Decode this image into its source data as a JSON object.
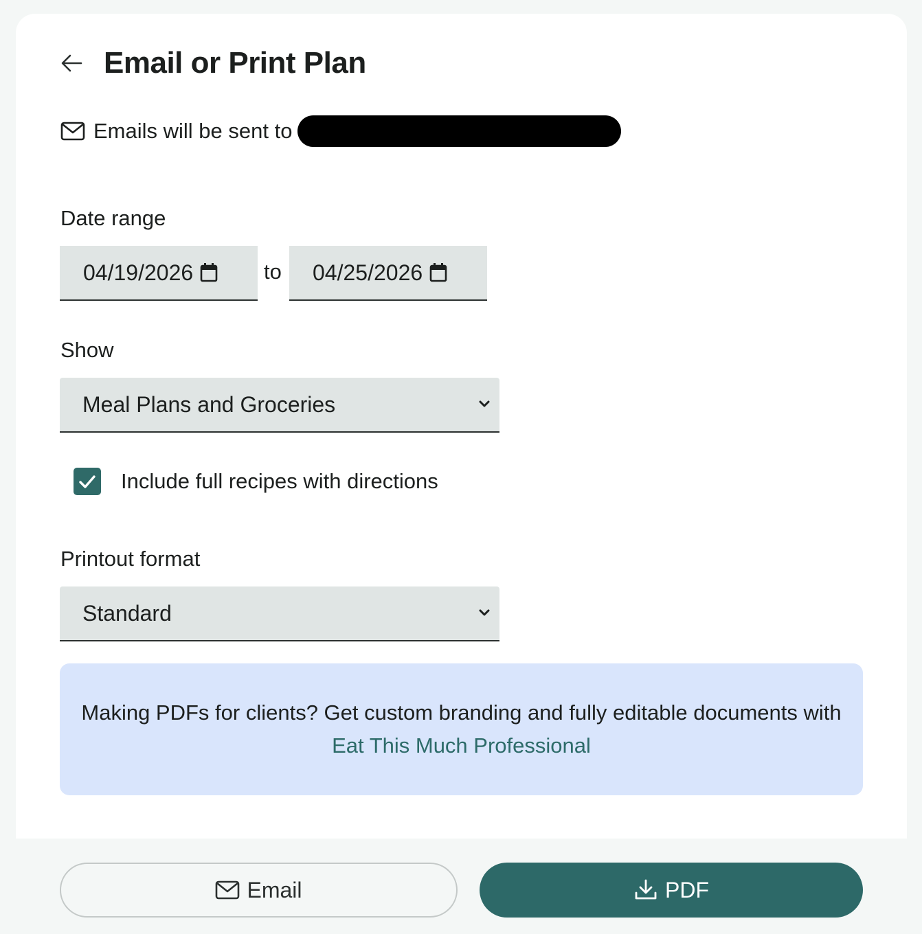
{
  "header": {
    "title": "Email or Print Plan",
    "back_icon": "arrow-left-icon"
  },
  "email_notice": {
    "text": "Emails will be sent to",
    "icon": "mail-icon",
    "recipient": "[redacted]"
  },
  "date_range": {
    "label": "Date range",
    "start": "04/19/2026",
    "separator": "to",
    "end": "04/25/2026",
    "icon": "calendar-icon"
  },
  "show": {
    "label": "Show",
    "selected": "Meal Plans and Groceries"
  },
  "include_recipes": {
    "label": "Include full recipes with directions",
    "checked": true
  },
  "printout_format": {
    "label": "Printout format",
    "selected": "Standard"
  },
  "promo": {
    "text": "Making PDFs for clients? Get custom branding and fully editable documents with",
    "link_text": "Eat This Much Professional"
  },
  "actions": {
    "email_label": "Email",
    "pdf_label": "PDF"
  },
  "colors": {
    "accent": "#2d6968",
    "field_bg": "#e0e5e4",
    "promo_bg": "#d9e5fc"
  }
}
